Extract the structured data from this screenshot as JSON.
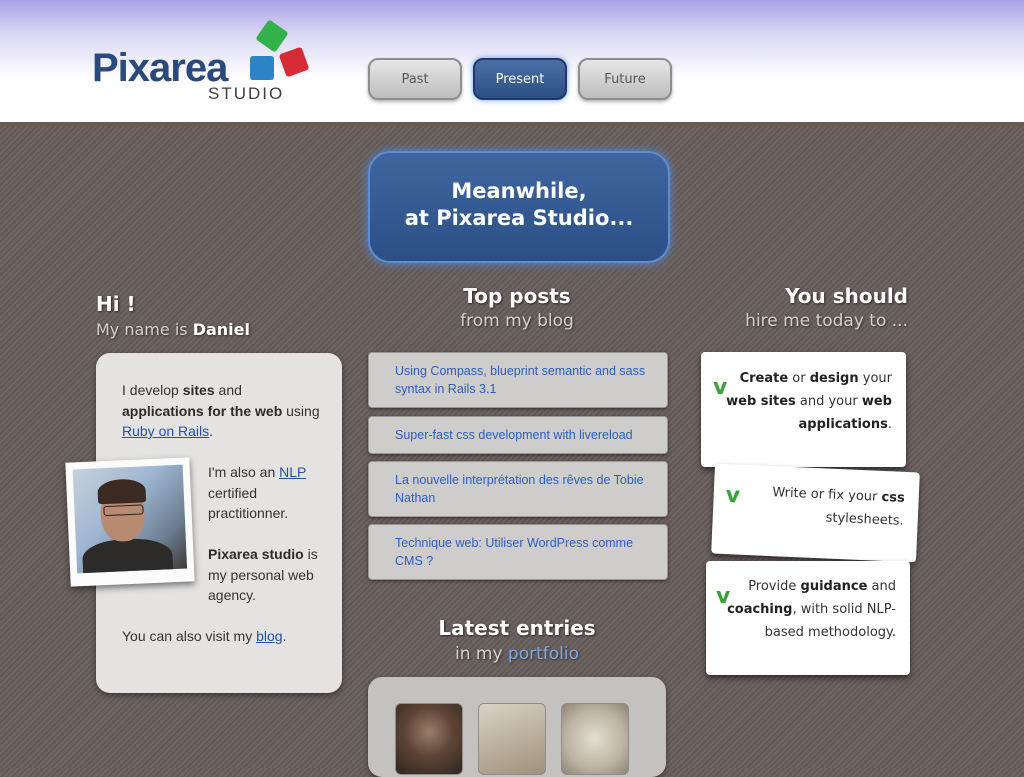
{
  "brand": {
    "name": "Pixarea",
    "sub": "STUDIO"
  },
  "nav": [
    {
      "label": "Past"
    },
    {
      "label": "Present"
    },
    {
      "label": "Future"
    }
  ],
  "hero": {
    "line1": "Meanwhile,",
    "line2": "at Pixarea Studio..."
  },
  "intro": {
    "hi": "Hi !",
    "name_prefix": "My name is",
    "name": "Daniel"
  },
  "about": {
    "p1": [
      "I develop",
      "sites",
      "and",
      "applications for the web",
      "using"
    ],
    "rails_link": "Ruby on Rails",
    "p2_pre": "I'm also an",
    "nlp_link": "NLP",
    "p2_post": "certified practitionner.",
    "p3_brand": "Pixarea studio",
    "p3_post": "is my personal web agency.",
    "p4_pre": "You can also visit my",
    "blog_link": "blog"
  },
  "top_posts": {
    "title": "Top posts",
    "subtitle": "from my blog",
    "items": [
      "Using Compass, blueprint semantic and sass syntax in Rails 3.1",
      "Super-fast css development with livereload",
      "La nouvelle interprétation des rêves de Tobie Nathan",
      "Technique web: Utiliser WordPress comme CMS ?"
    ]
  },
  "latest": {
    "title": "Latest entries",
    "subtitle_pre": "in my",
    "portfolio_link": "portfolio"
  },
  "hire": {
    "title": "You should",
    "subtitle": "hire me today to ...",
    "cards": [
      {
        "b1": "Create",
        "t1": "or",
        "b2": "design",
        "t2": "your",
        "b3": "web sites",
        "t3": "and your",
        "b4": "web",
        "b5": "applications",
        "t4": "."
      },
      {
        "t1": "Write or fix your",
        "b1": "css",
        "t2": "stylesheets."
      },
      {
        "t1": "Provide",
        "b1": "guidance",
        "t2": "and",
        "b2": "coaching",
        "t3": ", with solid",
        "t4": "NLP-based methodology."
      }
    ]
  },
  "colors": {
    "accent": "#2d4f85",
    "link": "#2251a8",
    "check": "#3aa23a",
    "portfolio_link": "#7ea9e6"
  },
  "icons": [
    "logo-squares-icon",
    "check-icon",
    "portrait-photo",
    "portfolio-thumbnail"
  ]
}
